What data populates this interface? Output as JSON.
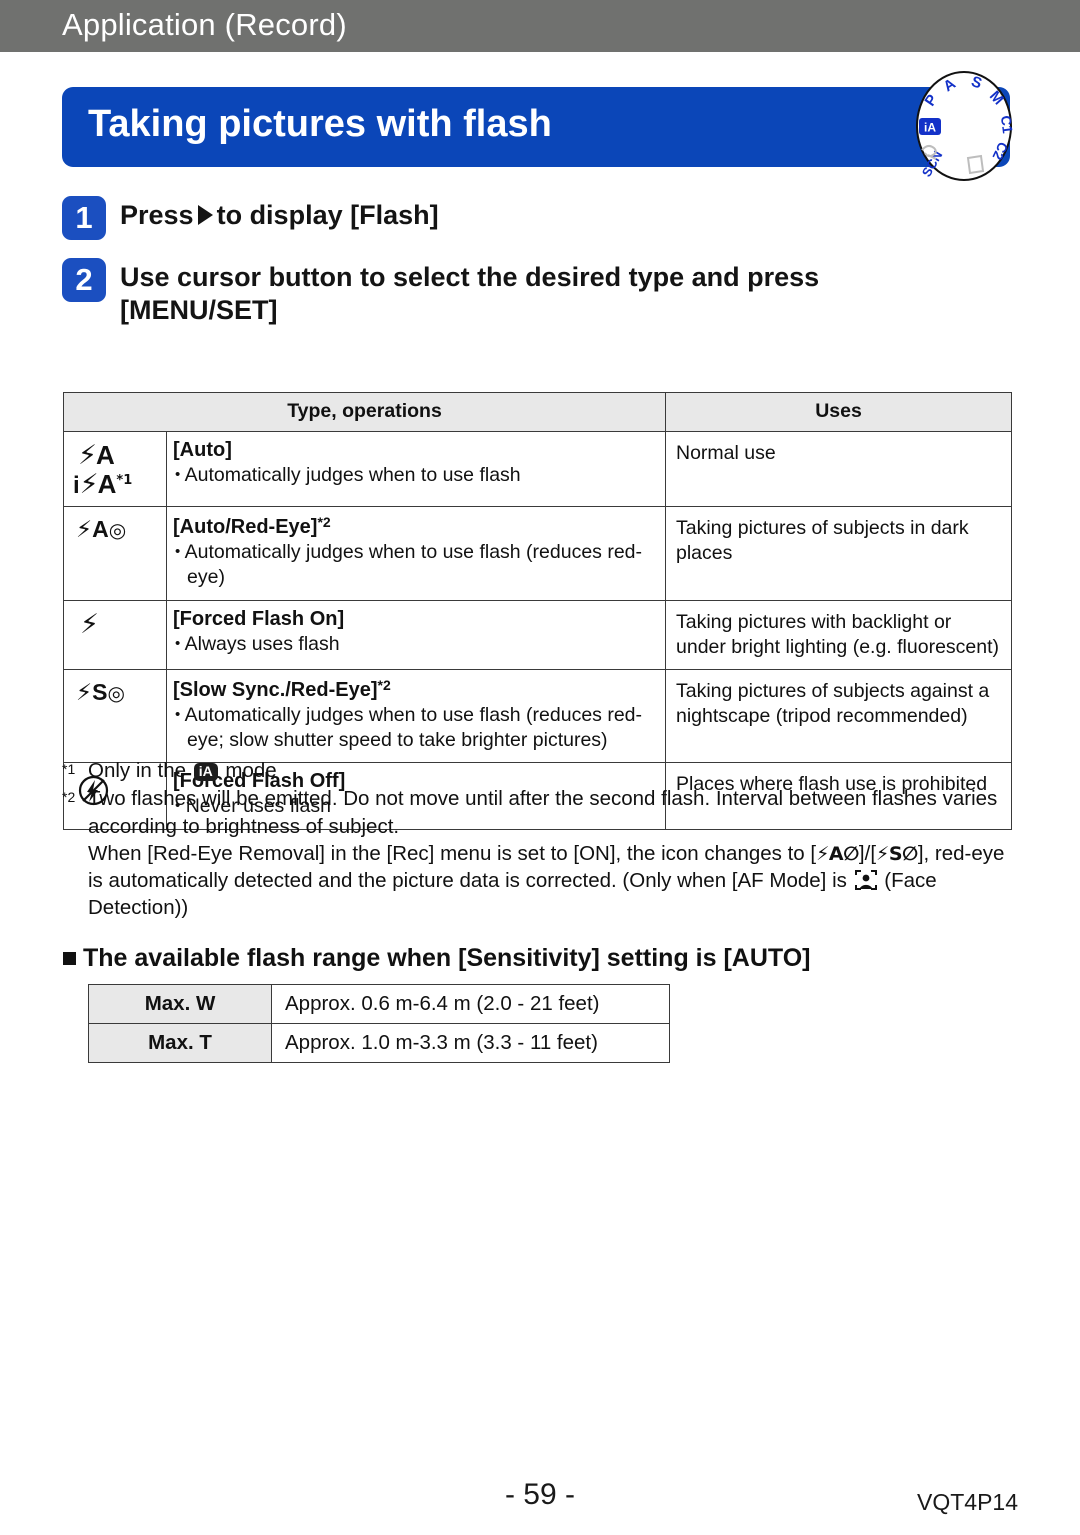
{
  "header": {
    "section_label": "Application (Record)"
  },
  "title_banner": {
    "title": "Taking pictures with flash"
  },
  "mode_dial": {
    "active_mode": "iA",
    "modes": [
      "iA",
      "P",
      "A",
      "S",
      "M",
      "C1",
      "C2",
      "panorama",
      "SCN",
      "creative-control"
    ]
  },
  "steps": [
    {
      "number": "1",
      "text_before": "Press",
      "text_after": "to display [Flash]"
    },
    {
      "number": "2",
      "text_before": "",
      "text_after": "Use cursor button to select the desired type and press [MENU/SET]"
    }
  ],
  "flash_table": {
    "headers": [
      "Type, operations",
      "Uses"
    ],
    "rows": [
      {
        "icons": [
          "⚡A",
          "i⚡A*1"
        ],
        "name": "[Auto]",
        "note_mark": "",
        "bullets": [
          "Automatically judges when to use flash"
        ],
        "uses": "Normal use"
      },
      {
        "icons": [
          "⚡A◎"
        ],
        "name": "[Auto/Red-Eye]",
        "note_mark": "*2",
        "bullets": [
          "Automatically judges when to use flash (reduces red-eye)"
        ],
        "uses": "Taking pictures of subjects in dark places"
      },
      {
        "icons": [
          "⚡"
        ],
        "name": "[Forced Flash On]",
        "note_mark": "",
        "bullets": [
          "Always uses flash"
        ],
        "uses": "Taking pictures with backlight or under bright lighting (e.g. fluorescent)"
      },
      {
        "icons": [
          "⚡S◎"
        ],
        "name": "[Slow Sync./Red-Eye]",
        "note_mark": "*2",
        "bullets": [
          "Automatically judges when to use flash (reduces red-eye; slow shutter speed to take brighter pictures)"
        ],
        "uses": "Taking pictures of subjects against a nightscape (tripod recommended)"
      },
      {
        "icons": [
          "⚡⊘"
        ],
        "name": "[Forced Flash Off]",
        "note_mark": "",
        "bullets": [
          "Never uses flash"
        ],
        "uses": "Places where flash use is prohibited"
      }
    ]
  },
  "footnotes": {
    "note1": {
      "mark": "*1",
      "text_before": "Only in the",
      "icon": "iA",
      "text_after": "mode"
    },
    "note2": {
      "mark": "*2",
      "paragraph1": "Two flashes will be emitted. Do not move until after the second flash. Interval between flashes varies according to brightness of subject.",
      "paragraph2_a": "When [Red-Eye Removal] in the [Rec] menu is set to [ON], the icon changes to [",
      "icon_a": "⚡A⊘",
      "paragraph2_b": "]/[",
      "icon_b": "⚡S⊘",
      "paragraph2_c": "], red-eye is automatically detected and the picture data is corrected. (Only when [AF Mode] is",
      "icon_face": "face-detection",
      "paragraph2_d": "(Face Detection))"
    }
  },
  "sub_heading": {
    "text": "The available flash range when [Sensitivity] setting is [AUTO]"
  },
  "range_table": {
    "rows": [
      {
        "key": "Max. W",
        "value": "Approx. 0.6 m-6.4 m (2.0 - 21 feet)"
      },
      {
        "key": "Max. T",
        "value": "Approx. 1.0 m-3.3 m (3.3 - 11 feet)"
      }
    ]
  },
  "footer": {
    "page": "- 59 -",
    "code": "VQT4P14"
  },
  "colors": {
    "header_bar": "#70716f",
    "banner_blue": "#0b46b8",
    "badge_blue": "#1b4fc0",
    "table_header_gray": "#e8e8e8",
    "border": "#3a3a3a"
  }
}
